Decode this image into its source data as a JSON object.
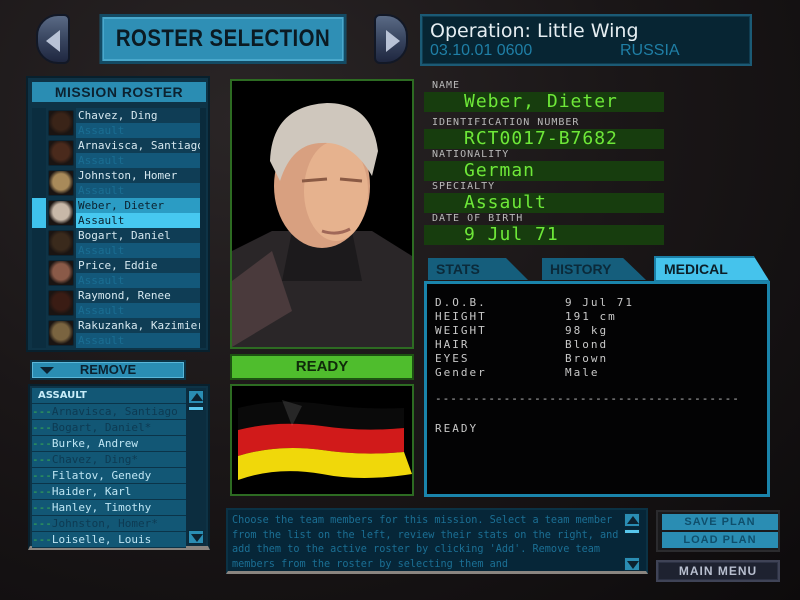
{
  "header": {
    "title": "ROSTER SELECTION",
    "prev_icon": "triangle-left-icon",
    "next_icon": "triangle-right-icon",
    "operation": "Operation: Little Wing",
    "date_time": "03.10.01 0600",
    "location": "RUSSIA"
  },
  "mission_roster": {
    "title": "MISSION ROSTER",
    "items": [
      {
        "name": "Chavez, Ding",
        "specialty": "Assault",
        "portrait_color": "#3a2418",
        "selected": false
      },
      {
        "name": "Arnavisca, Santiago",
        "specialty": "Assault",
        "portrait_color": "#4a2a1c",
        "selected": false
      },
      {
        "name": "Johnston, Homer",
        "specialty": "Assault",
        "portrait_color": "#a88a5a",
        "selected": false
      },
      {
        "name": "Weber, Dieter",
        "specialty": "Assault",
        "portrait_color": "#c8b8a8",
        "selected": true
      },
      {
        "name": "Bogart, Daniel",
        "specialty": "Assault",
        "portrait_color": "#3a2a1c",
        "selected": false
      },
      {
        "name": "Price, Eddie",
        "specialty": "Assault",
        "portrait_color": "#8a5a48",
        "selected": false
      },
      {
        "name": "Raymond, Renee",
        "specialty": "Assault",
        "portrait_color": "#3a1c14",
        "selected": false
      },
      {
        "name": "Rakuzanka, Kazimier",
        "specialty": "Assault",
        "portrait_color": "#7a6440",
        "selected": false
      }
    ]
  },
  "remove_button": {
    "label": "REMOVE",
    "icon": "triangle-down-icon"
  },
  "available": {
    "category": "ASSAULT",
    "prefix": "---",
    "items": [
      {
        "name": "Arnavisca, Santiago",
        "assigned": true
      },
      {
        "name": "Bogart, Daniel*",
        "assigned": true
      },
      {
        "name": "Burke, Andrew",
        "assigned": false
      },
      {
        "name": "Chavez, Ding*",
        "assigned": true
      },
      {
        "name": "Filatov, Genedy",
        "assigned": false
      },
      {
        "name": "Haider, Karl",
        "assigned": false
      },
      {
        "name": "Hanley, Timothy",
        "assigned": false
      },
      {
        "name": "Johnston, Homer*",
        "assigned": true
      },
      {
        "name": "Loiselle, Louis",
        "assigned": false
      }
    ]
  },
  "operative": {
    "status": "READY",
    "flag": "Germany",
    "flag_colors": [
      "#0a0a0a",
      "#d11a1a",
      "#f0d80a"
    ],
    "fields": [
      {
        "label": "NAME",
        "value": "Weber, Dieter"
      },
      {
        "label": "IDENTIFICATION NUMBER",
        "value": "RCT0017-B7682"
      },
      {
        "label": "NATIONALITY",
        "value": "German"
      },
      {
        "label": "SPECIALTY",
        "value": "Assault"
      },
      {
        "label": "DATE OF BIRTH",
        "value": "9 Jul 71"
      }
    ]
  },
  "tabs": [
    {
      "label": "STATS",
      "active": false
    },
    {
      "label": "HISTORY",
      "active": false
    },
    {
      "label": "MEDICAL",
      "active": true
    }
  ],
  "medical": {
    "rows": [
      {
        "key": "D.O.B.",
        "value": "9 Jul 71"
      },
      {
        "key": "HEIGHT",
        "value": "191 cm"
      },
      {
        "key": "WEIGHT",
        "value": "98 kg"
      },
      {
        "key": "HAIR",
        "value": "Blond"
      },
      {
        "key": "EYES",
        "value": "Brown"
      },
      {
        "key": "Gender",
        "value": "Male"
      }
    ],
    "divider": "----------------------------------------",
    "status": "READY"
  },
  "description": "Choose the team members for this mission. Select a team member from the list on the left, review their stats on the right, and add them to the active roster by clicking 'Add'. Remove team members from the roster by selecting them and",
  "buttons": {
    "save_plan": "SAVE PLAN",
    "load_plan": "LOAD PLAN",
    "main_menu": "MAIN MENU"
  },
  "colors": {
    "accent_blue": "#2a8db3",
    "selected_blue": "#46c8f0",
    "info_green": "#6ee838",
    "ready_green": "#4fbd2d"
  }
}
